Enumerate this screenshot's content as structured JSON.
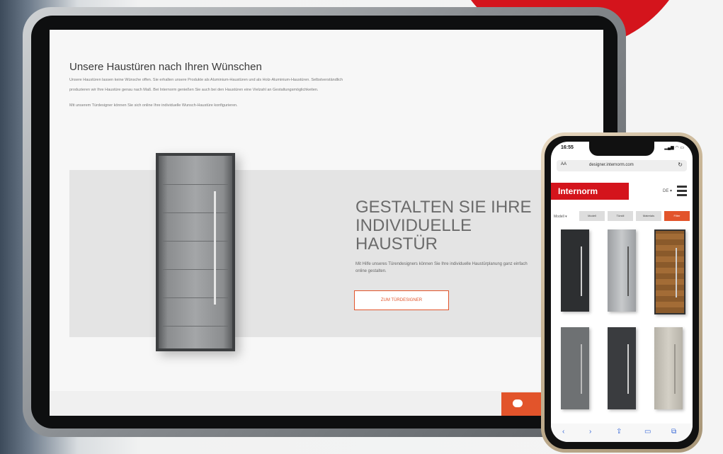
{
  "tablet": {
    "page_title": "Unsere Haustüren nach Ihren Wünschen",
    "para1_line1": "Unsere Haustüren lassen keine Wünsche offen. Sie erhalten unsere Produkte als Aluminium-Haustüren und als Holz-Aluminium-Haustüren. Selbstverständlich",
    "para1_line2": "produzieren wir Ihre Haustüre genau nach Maß. Bei Internorm genießen Sie auch bei den Haustüren eine Vielzahl an Gestaltungsmöglichkeiten.",
    "para2": "Mit unserem Türdesigner können Sie sich online Ihre individuelle Wunsch-Haustüre konfigurieren.",
    "hero_headline": "GESTALTEN SIE IHRE\nINDIVIDUELLE\nHAUSTÜR",
    "hero_text": "Mit Hilfe unseres Türendesigners können Sie Ihre individuelle Haustürplanung ganz einfach online gestalten.",
    "hero_button": "ZUM TÜRDESIGNER",
    "chat_icon": "chat-bubble-icon"
  },
  "phone": {
    "time": "16:55",
    "status": "▂▄▆ ◠ ▭",
    "url_aa": "AA",
    "url": "designer.internorm.com",
    "reload_icon": "↻",
    "logo": "Internorm",
    "lang": "DE ▾",
    "filter_label": "Modell ▾",
    "chips": [
      "Modell",
      "Türstil",
      "Materials",
      "Filter"
    ],
    "toolbar_icons": [
      "‹",
      "›",
      "⇪",
      "▭",
      "⧉"
    ]
  },
  "colors": {
    "brand_red": "#d4141c",
    "accent_orange": "#e2542b"
  }
}
